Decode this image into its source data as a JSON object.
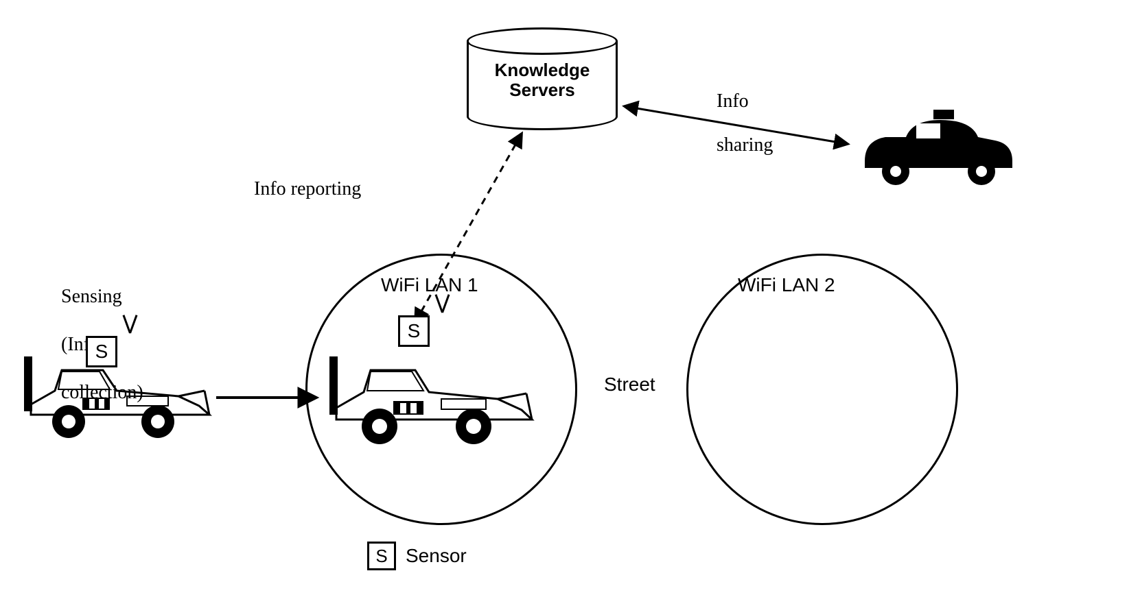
{
  "labels": {
    "sensing_line1": "Sensing",
    "sensing_line2": "(Info",
    "sensing_line3": "collection)",
    "info_reporting": "Info reporting",
    "info_sharing_line1": "Info",
    "info_sharing_line2": "sharing",
    "wifi1": "WiFi LAN 1",
    "wifi2": "WiFi LAN 2",
    "street": "Street",
    "knowledge_line1": "Knowledge",
    "knowledge_line2": "Servers",
    "sensor_letter": "S",
    "legend_sensor": "Sensor"
  }
}
